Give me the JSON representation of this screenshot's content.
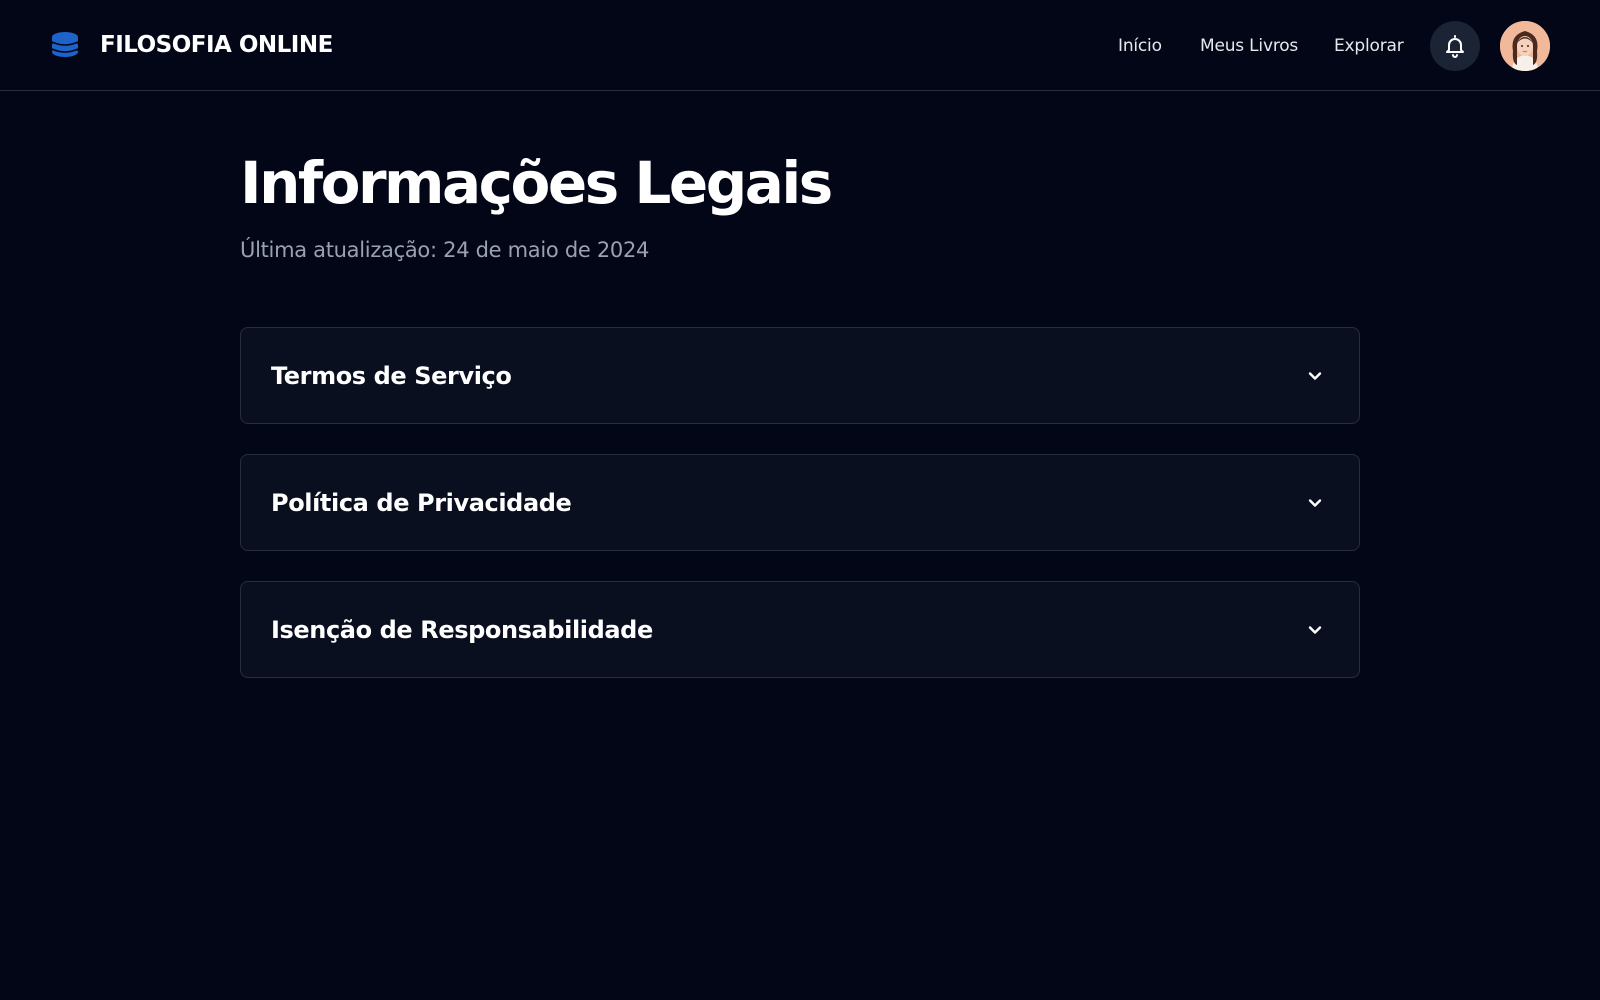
{
  "header": {
    "brand": "FILOSOFIA ONLINE",
    "nav": [
      {
        "label": "Início"
      },
      {
        "label": "Meus Livros"
      },
      {
        "label": "Explorar"
      }
    ],
    "logo_icon": "database-stack-icon",
    "notification_icon": "bell-icon",
    "avatar_icon": "user-avatar"
  },
  "main": {
    "title": "Informações Legais",
    "last_updated": "Última atualização: 24 de maio de 2024",
    "sections": [
      {
        "title": "Termos de Serviço"
      },
      {
        "title": "Política de Privacidade"
      },
      {
        "title": "Isenção de Responsabilidade"
      }
    ]
  },
  "colors": {
    "background": "#030616",
    "card": "#0a0f1f",
    "border": "#272d3c",
    "accent": "#1d63c9",
    "muted_text": "#9aa1b2"
  }
}
